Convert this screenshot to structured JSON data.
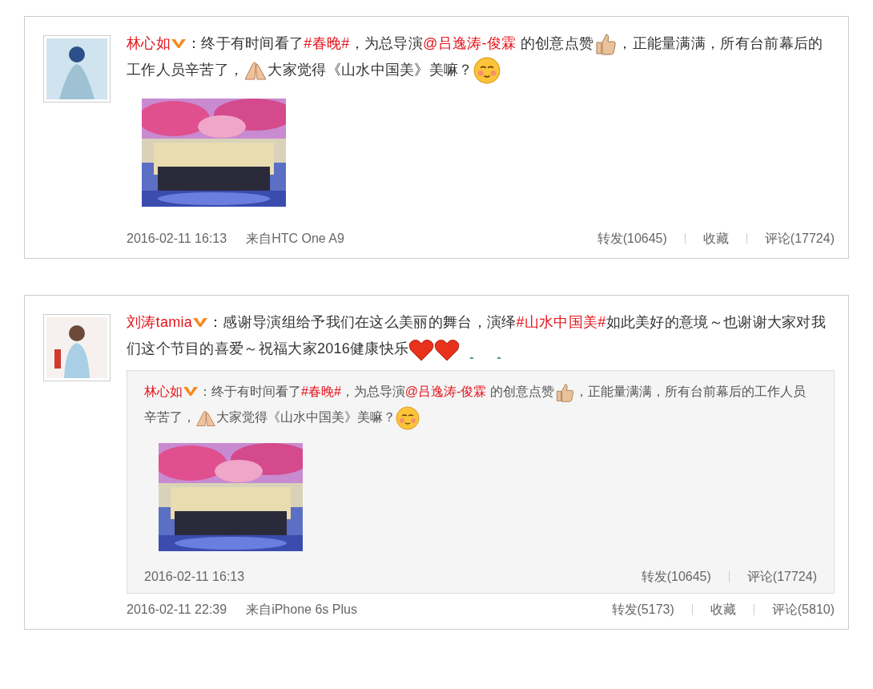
{
  "posts": [
    {
      "author": "林心如",
      "verified": true,
      "content": [
        {
          "kind": "text",
          "text": "：终于有时间看了"
        },
        {
          "kind": "link",
          "text": "#春晚#"
        },
        {
          "kind": "text",
          "text": "，为总导演"
        },
        {
          "kind": "link",
          "text": "@吕逸涛-俊霖"
        },
        {
          "kind": "text",
          "text": " 的创意点赞"
        },
        {
          "kind": "thumbsup"
        },
        {
          "kind": "text",
          "text": "，正能量满满，所有台前幕后的工作人员辛苦了，"
        },
        {
          "kind": "pray"
        },
        {
          "kind": "text",
          "text": "大家觉得《山水中国美》美嘛？"
        },
        {
          "kind": "blush"
        }
      ],
      "media": {
        "kind": "picture"
      },
      "time": "2016-02-11 16:13",
      "source": "来自HTC One A9",
      "actions": [
        "转发(10645)",
        "收藏",
        "评论(17724)"
      ]
    },
    {
      "author": "刘涛tamia",
      "verified": true,
      "content": [
        {
          "kind": "text",
          "text": "：感谢导演组给予我们在这么美丽的舞台，演绎"
        },
        {
          "kind": "link",
          "text": "#山水中国美#"
        },
        {
          "kind": "text",
          "text": "如此美好的意境～也谢谢大家对我们这个节目的喜爱～祝福大家2016健康快乐"
        },
        {
          "kind": "heart"
        },
        {
          "kind": "heart"
        },
        {
          "kind": "sprout"
        }
      ],
      "repost": {
        "author": "林心如",
        "verified": true,
        "content": [
          {
            "kind": "text",
            "text": "：终于有时间看了"
          },
          {
            "kind": "link",
            "text": "#春晚#"
          },
          {
            "kind": "text",
            "text": "，为总导演"
          },
          {
            "kind": "link",
            "text": "@吕逸涛-俊霖"
          },
          {
            "kind": "text",
            "text": " 的创意点赞"
          },
          {
            "kind": "thumbsup"
          },
          {
            "kind": "text",
            "text": "，正能量满满，所有台前幕后的工作人员辛苦了，"
          },
          {
            "kind": "pray"
          },
          {
            "kind": "text",
            "text": "大家觉得《山水中国美》美嘛？"
          },
          {
            "kind": "blush"
          }
        ],
        "media": {
          "kind": "picture"
        },
        "time": "2016-02-11 16:13",
        "actions": [
          "转发(10645)",
          "评论(17724)"
        ]
      },
      "time": "2016-02-11 22:39",
      "source": "来自iPhone 6s Plus",
      "actions": [
        "转发(5173)",
        "收藏",
        "评论(5810)"
      ]
    }
  ]
}
